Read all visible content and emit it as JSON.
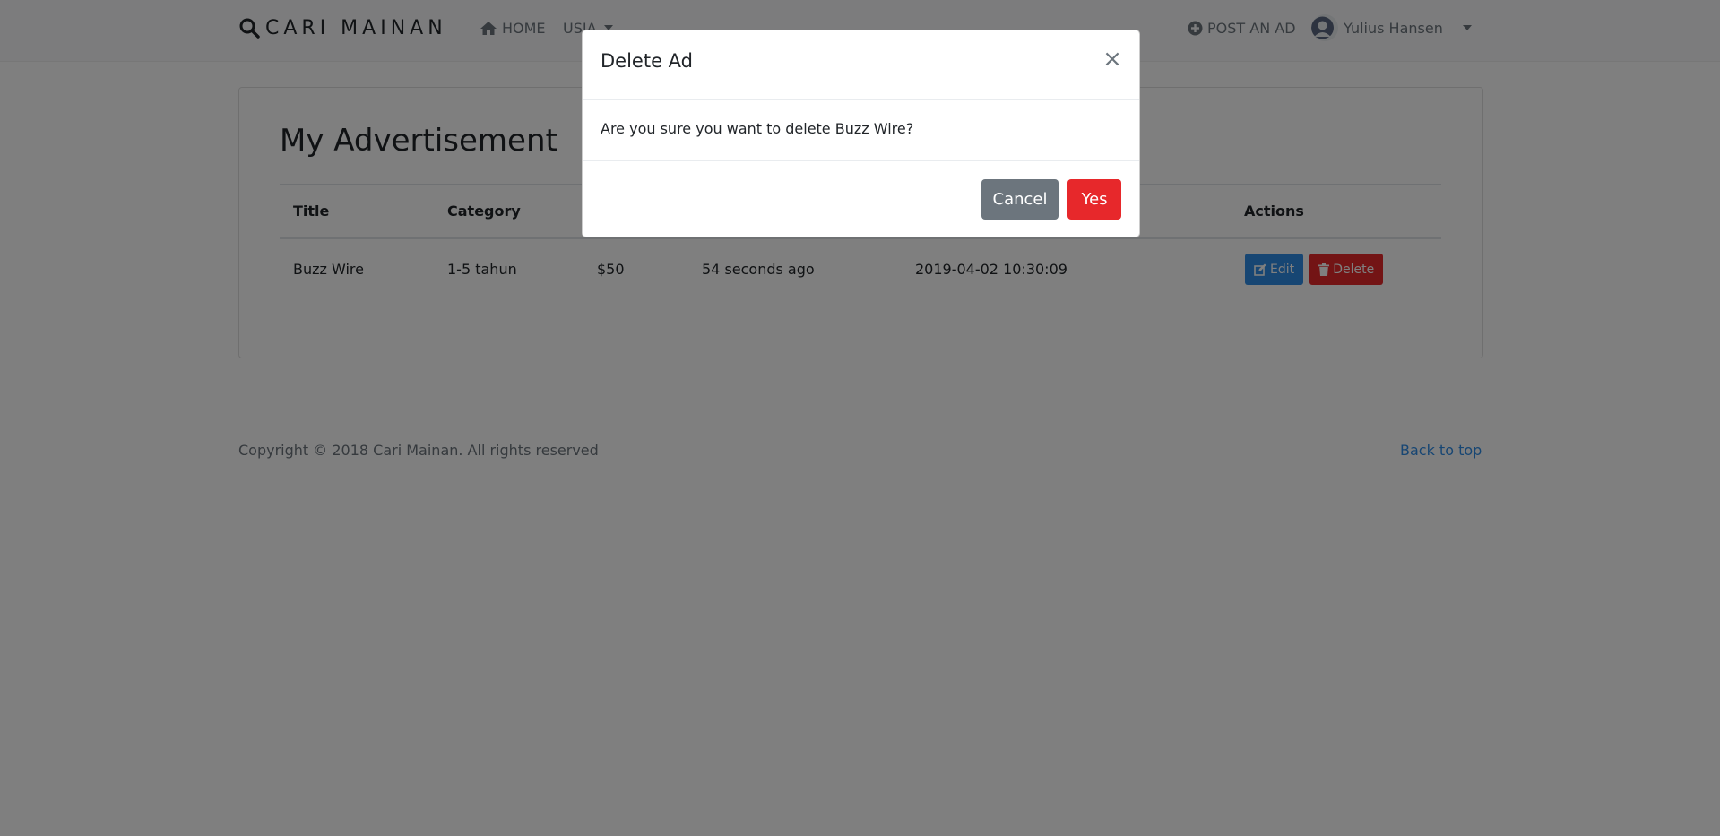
{
  "navbar": {
    "brand": "CARI MAINAN",
    "home": "HOME",
    "age_dropdown": "USIA",
    "post_ad": "POST AN AD",
    "user_name": "Yulius Hansen"
  },
  "main": {
    "title": "My Advertisement",
    "columns": [
      "Title",
      "Category",
      "",
      "",
      "",
      "Actions"
    ],
    "rows": [
      {
        "title": "Buzz Wire",
        "category": "1-5 tahun",
        "price": "$50",
        "posted": "54 seconds ago",
        "date": "2019-04-02 10:30:09",
        "edit_label": "Edit",
        "delete_label": "Delete"
      }
    ]
  },
  "footer": {
    "copyright": "Copyright © 2018 Cari Mainan. All rights reserved",
    "back_to_top": "Back to top"
  },
  "modal": {
    "title": "Delete Ad",
    "close_glyph": "×",
    "message": "Are you sure you want to delete Buzz Wire?",
    "cancel_label": "Cancel",
    "yes_label": "Yes"
  },
  "colors": {
    "primary": "#2f8ce6",
    "danger": "#e7282b",
    "secondary": "#6c757d"
  }
}
